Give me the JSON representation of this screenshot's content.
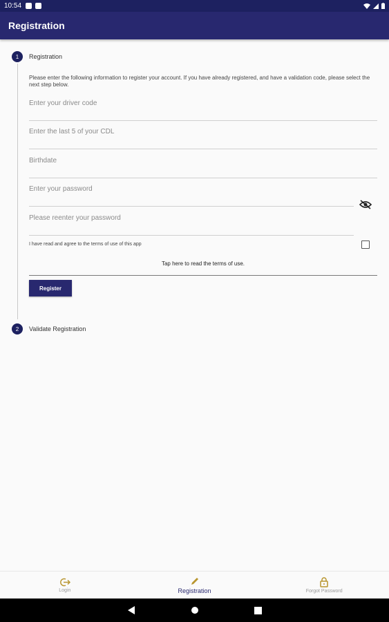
{
  "status_bar": {
    "time": "10:54"
  },
  "app_bar": {
    "title": "Registration"
  },
  "steps": [
    {
      "number": "1",
      "title": "Registration"
    },
    {
      "number": "2",
      "title": "Validate Registration"
    }
  ],
  "form": {
    "description": "Please enter the following information to register your account. If you have already registered, and have a validation code, please select the next step below.",
    "driver_code_placeholder": "Enter your driver code",
    "cdl_placeholder": "Enter the last 5 of your CDL",
    "birthdate_placeholder": "Birthdate",
    "password_placeholder": "Enter your password",
    "reenter_password_placeholder": "Please reenter your password",
    "terms_label": "I have read and agree to the terms of use of this app",
    "terms_checked": false,
    "terms_link": "Tap here to read the terms of use.",
    "register_label": "Register"
  },
  "bottom_nav": {
    "items": [
      {
        "label": "Login",
        "icon": "login-icon"
      },
      {
        "label": "Registration",
        "icon": "pencil-icon",
        "active": true
      },
      {
        "label": "Forgot Password",
        "icon": "lock-icon"
      }
    ]
  },
  "colors": {
    "primary": "#28286f",
    "status_bar": "#1d2160",
    "icon_gold": "#b8952e"
  }
}
